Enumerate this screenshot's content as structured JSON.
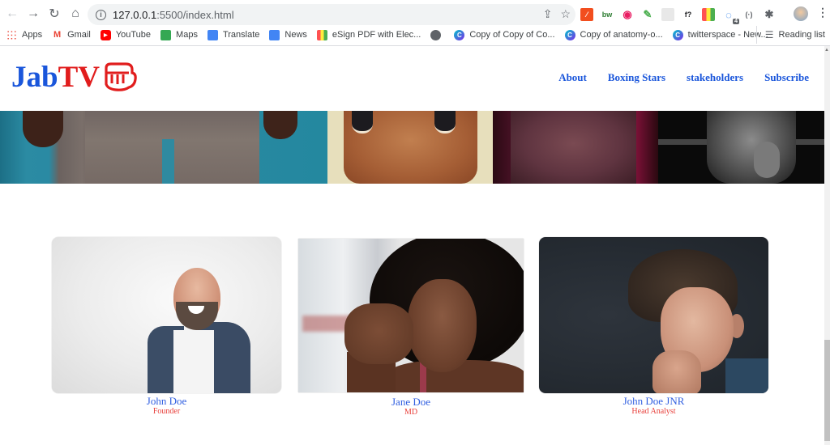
{
  "browser": {
    "url_host": "127.0.0.1",
    "url_path": ":5500/index.html",
    "back_icon": "arrow-left",
    "forward_icon": "arrow-right",
    "reload_icon": "reload",
    "home_icon": "home",
    "extensions": [
      {
        "name": "ext-code-icon",
        "glyph": "⁄",
        "color": "#f24e1e"
      },
      {
        "name": "ext-bw-icon",
        "glyph": "bw",
        "color": "#2e7d32"
      },
      {
        "name": "ext-eye-icon",
        "glyph": "◉",
        "color": "#e91e63"
      },
      {
        "name": "ext-eyedropper-icon",
        "glyph": "✎",
        "color": "#4caf50"
      },
      {
        "name": "ext-blank-icon",
        "glyph": "",
        "color": "#e8e8e8"
      },
      {
        "name": "ext-font-icon",
        "glyph": "f?",
        "color": "#202124"
      },
      {
        "name": "ext-palette-icon",
        "glyph": "",
        "color": "#ff5722"
      },
      {
        "name": "ext-loading-icon",
        "glyph": "◌",
        "color": "#1a73e8",
        "badge": "4"
      },
      {
        "name": "ext-dots-icon",
        "glyph": "(·)",
        "color": "#5f6368"
      },
      {
        "name": "extensions-puzzle-icon",
        "glyph": "✱",
        "color": "#5f6368"
      }
    ],
    "bookmarks": [
      {
        "label": "Apps",
        "icon": "apps-grid-icon",
        "color": "#ea4335"
      },
      {
        "label": "Gmail",
        "icon": "gmail-icon",
        "color": "#ea4335"
      },
      {
        "label": "YouTube",
        "icon": "youtube-icon",
        "color": "#ff0000"
      },
      {
        "label": "Maps",
        "icon": "maps-icon",
        "color": "#34a853"
      },
      {
        "label": "Translate",
        "icon": "translate-icon",
        "color": "#4285f4"
      },
      {
        "label": "News",
        "icon": "news-icon",
        "color": "#4285f4"
      },
      {
        "label": "eSign PDF with Elec...",
        "icon": "esign-icon",
        "color": "#ff6d00"
      },
      {
        "label": "",
        "icon": "globe-icon",
        "color": "#5f6368"
      },
      {
        "label": "Copy of Copy of Co...",
        "icon": "canva-icon",
        "color": "#00c4cc"
      },
      {
        "label": "Copy of anatomy-o...",
        "icon": "canva-icon",
        "color": "#00c4cc"
      },
      {
        "label": "twitterspace - New...",
        "icon": "canva-icon",
        "color": "#7d2ae8"
      }
    ],
    "reading_list": "Reading list"
  },
  "site": {
    "logo_part1": "Jab",
    "logo_part2": "TV",
    "nav": [
      "About",
      "Boxing Stars",
      "stakeholders",
      "Subscribe"
    ],
    "colors": {
      "primary": "#1a56db",
      "accent": "#e11d1d",
      "name": "#2f5ee0",
      "role": "#e8413c"
    }
  },
  "team": [
    {
      "name": "John Doe",
      "role": "Founder"
    },
    {
      "name": "Jane Doe",
      "role": "MD"
    },
    {
      "name": "John Doe JNR",
      "role": "Head Analyst"
    }
  ]
}
